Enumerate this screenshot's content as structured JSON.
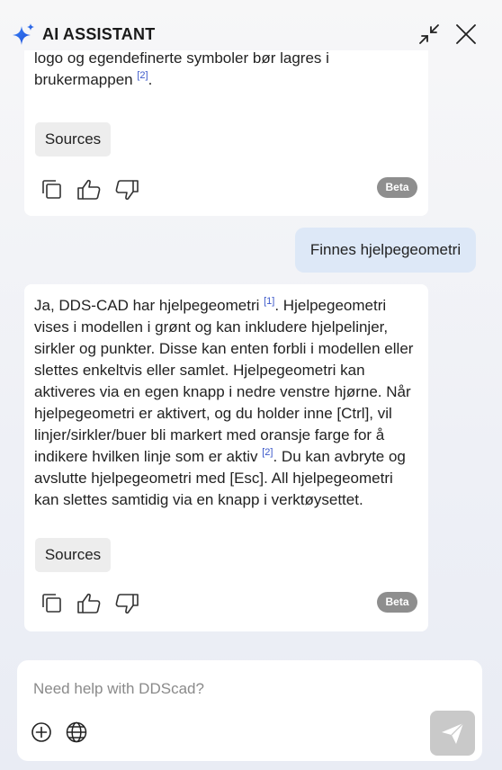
{
  "header": {
    "title": "AI ASSISTANT",
    "icons": {
      "logo": "sparkle-icon",
      "minimize": "collapse-icon",
      "close": "close-icon"
    }
  },
  "messages": [
    {
      "role": "assistant",
      "text": "tittelblokkene bruke den nye logoen. Husk at tittel felt, logo og egendefinerte symboler bør lagres i brukermappen",
      "ref": "[2]",
      "tail": ".",
      "sources_label": "Sources",
      "badge": "Beta"
    },
    {
      "role": "user",
      "text": "Finnes hjelpegeometri"
    },
    {
      "role": "assistant",
      "part1": "Ja, DDS-CAD har hjelpegeometri",
      "ref1": "[1]",
      "part2": ". Hjelpegeometri vises i modellen i grønt og kan inkludere hjelpelinjer, sirkler og punkter. Disse kan enten forbli i modellen eller slettes enkeltvis eller samlet. Hjelpegeometri kan aktiveres via en egen knapp i nedre venstre hjørne. Når hjelpegeometri er aktivert, og du holder inne [Ctrl], vil linjer/sirkler/buer bli markert med oransje farge for å indikere hvilken linje som er aktiv",
      "ref2": "[2]",
      "part3": ". Du kan avbryte og avslutte hjelpegeometri med [Esc]. All hjelpegeometri kan slettes samtidig via en knapp i verktøysettet.",
      "sources_label": "Sources",
      "badge": "Beta"
    }
  ],
  "composer": {
    "placeholder": "Need help with DDScad?",
    "value": "",
    "icons": [
      "add-circle-icon",
      "globe-icon",
      "send-icon"
    ]
  },
  "colors": {
    "accent": "#2f6de1",
    "user_bubble": "#dde8f7",
    "badge": "#8e8e8e",
    "send_button": "#c9c9c9",
    "reference_link": "#3a57c9"
  }
}
